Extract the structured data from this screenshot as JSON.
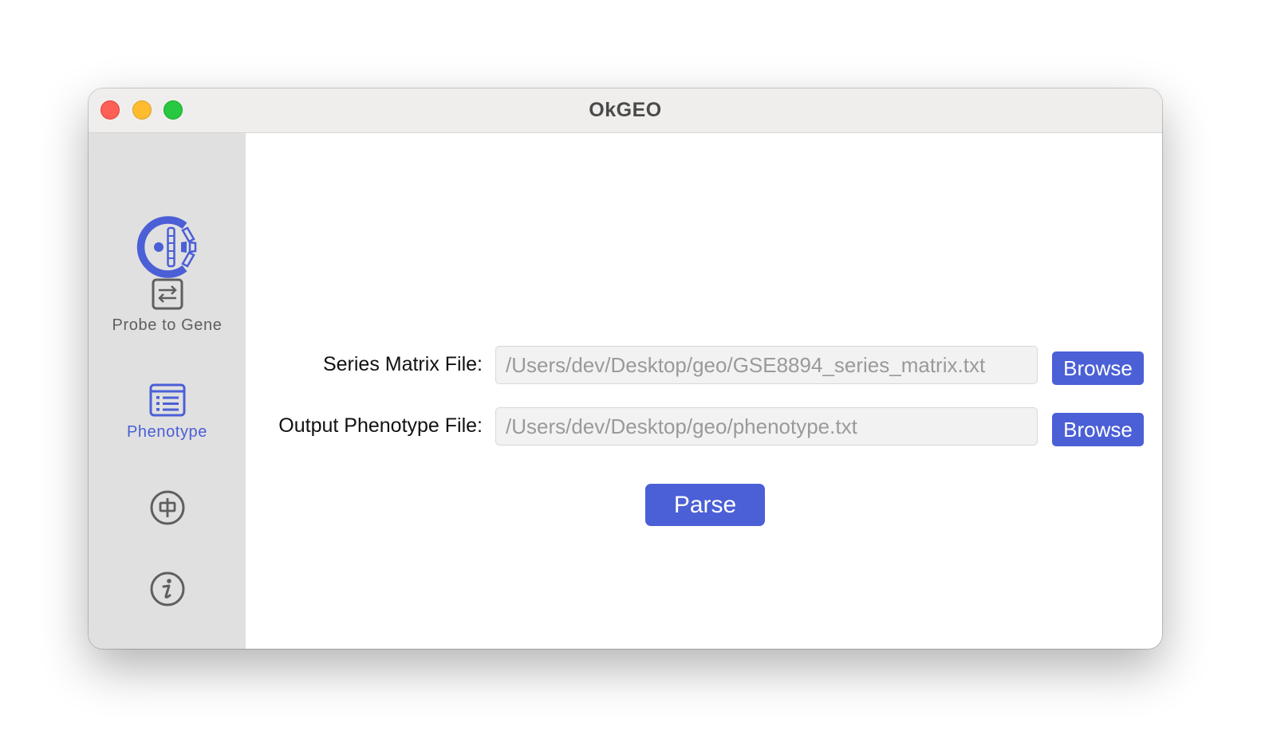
{
  "window": {
    "title": "OkGEO"
  },
  "sidebar": {
    "logo": "okgeo-logo",
    "items": [
      {
        "label": "Probe to Gene",
        "icon": "swap-arrows-icon",
        "active": false
      },
      {
        "label": "Phenotype",
        "icon": "list-icon",
        "active": true
      },
      {
        "label": "",
        "icon": "language-zh-icon",
        "active": false
      },
      {
        "label": "",
        "icon": "info-icon",
        "active": false
      }
    ]
  },
  "form": {
    "series_matrix_label": "Series Matrix File:",
    "series_matrix_value": "/Users/dev/Desktop/geo/GSE8894_series_matrix.txt",
    "output_label": "Output Phenotype File:",
    "output_value": "/Users/dev/Desktop/geo/phenotype.txt",
    "browse_label": "Browse",
    "parse_label": "Parse"
  },
  "colors": {
    "accent": "#4b5fd6",
    "sidebar_bg": "#e0e0e0",
    "titlebar_bg": "#efeeed",
    "close": "#fe5f57",
    "minimize": "#febc2e",
    "maximize": "#28c840"
  }
}
